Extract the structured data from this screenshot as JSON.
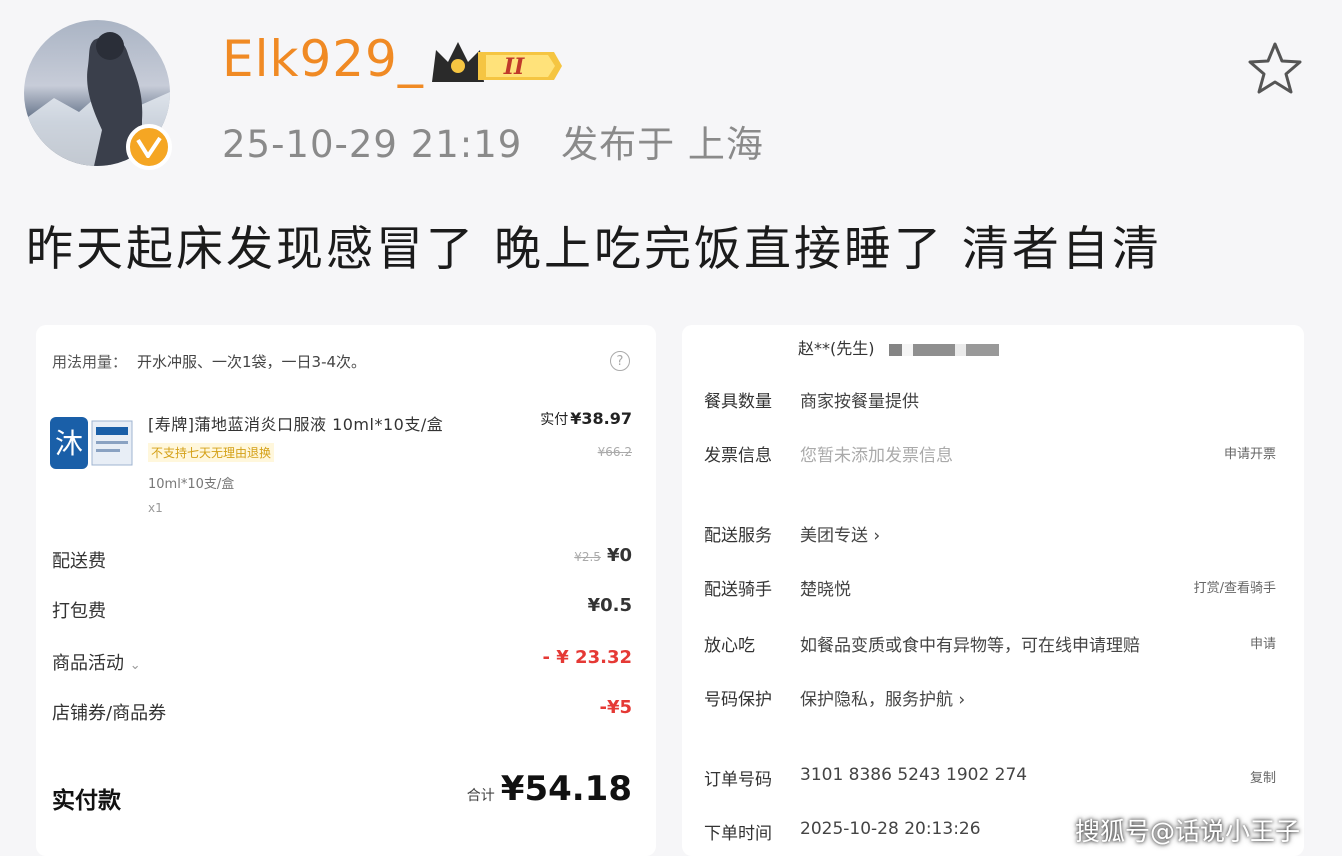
{
  "post": {
    "username": "Elk929_",
    "vip_level": "II",
    "timestamp": "25-10-29 21:19",
    "location": "发布于 上海",
    "text": "昨天起床发现感冒了 晚上吃完饭直接睡了  清者自清"
  },
  "order_left": {
    "usage_label": "用法用量：",
    "usage_value": "开水冲服、一次1袋，一日3-4次。",
    "product": {
      "name": "[寿牌]蒲地蓝消炎口服液 10ml*10支/盒",
      "tag": "不支持七天无理由退换",
      "spec": "10ml*10支/盒",
      "qty": "x1",
      "actual_label": "实付",
      "actual_price": "¥38.97",
      "original_price": "¥66.2"
    },
    "fees": [
      {
        "label": "配送费",
        "strike": "¥2.5",
        "value": "¥0"
      },
      {
        "label": "打包费",
        "strike": "",
        "value": "¥0.5"
      },
      {
        "label": "商品活动",
        "strike": "",
        "value": "- ¥ 23.32"
      },
      {
        "label": "店铺券/商品券",
        "strike": "",
        "value": "-¥5"
      }
    ],
    "total_label": "实付款",
    "total_prefix": "合计",
    "total_value": "¥54.18"
  },
  "order_right": {
    "recipient": "赵**(先生)",
    "rows": [
      {
        "key": "餐具数量",
        "value": "商家按餐量提供",
        "action": ""
      },
      {
        "key": "发票信息",
        "value": "您暂未添加发票信息",
        "action": "申请开票"
      },
      {
        "key": "配送服务",
        "value": "美团专送 ›",
        "action": ""
      },
      {
        "key": "配送骑手",
        "value": "楚晓悦",
        "action": "打赏/查看骑手"
      },
      {
        "key": "放心吃",
        "value": "如餐品变质或食中有异物等，可在线申请理赔",
        "action": "申请"
      },
      {
        "key": "号码保护",
        "value": "保护隐私，服务护航 ›",
        "action": ""
      },
      {
        "key": "订单号码",
        "value": "3101 8386 5243 1902 274",
        "action": "复制"
      },
      {
        "key": "下单时间",
        "value": "2025-10-28 20:13:26",
        "action": ""
      }
    ]
  },
  "watermark": "搜狐号@话说小王子",
  "colors": {
    "username": "#f08a24",
    "discount": "#e53935",
    "badge": "#f5a623"
  }
}
